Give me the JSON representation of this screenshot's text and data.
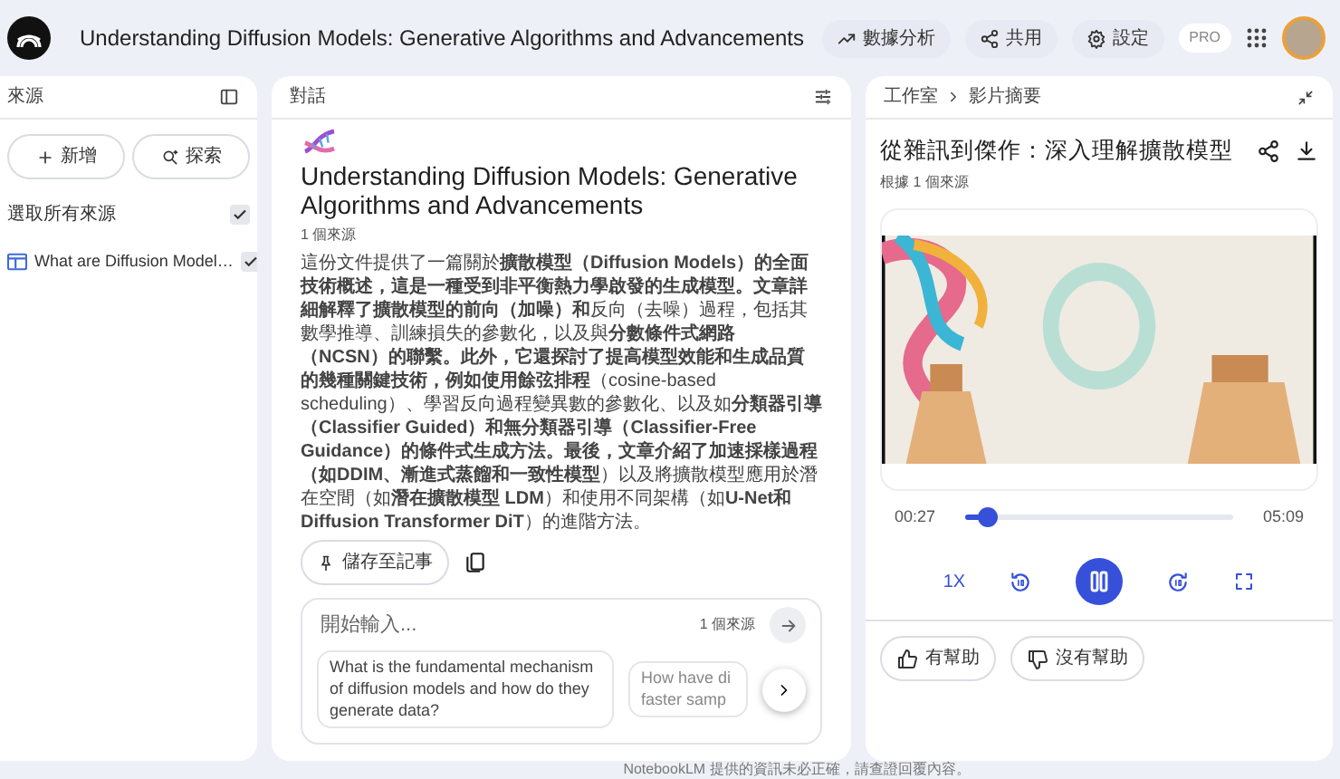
{
  "header": {
    "title": "Understanding Diffusion Models: Generative Algorithms and Advancements",
    "actions": [
      {
        "kind": "analytics",
        "label": "數據分析"
      },
      {
        "kind": "share",
        "label": "共用"
      },
      {
        "kind": "settings",
        "label": "設定"
      }
    ],
    "badge": "PRO"
  },
  "sources_panel": {
    "title": "來源",
    "buttons": [
      {
        "kind": "add",
        "label": "新增"
      },
      {
        "kind": "discover",
        "label": "探索"
      }
    ],
    "select_all": {
      "label": "選取所有來源",
      "checked": true
    },
    "sources": [
      {
        "title": "What are Diffusion Model…",
        "checked": true
      }
    ]
  },
  "chat_panel": {
    "title": "對話",
    "heading": "Understanding Diffusion Models: Generative Algorithms and Advancements",
    "source_count": "1 個來源",
    "summary": "這份文件提供了一篇關於**擴散模型（Diffusion Models）的全面技術概述，這是一種受到非平衡熱力學啟發的生成模型。文章詳細解釋了擴散模型的前向（加噪）和**反向（去噪）過程，包括其數學推導、訓練損失的參數化，以及與**分數條件式網路（NCSN）的聯繫。此外，它還探討了提高模型效能和生成品質的幾種關鍵技術，例如使用餘弦排程**（cosine-based scheduling）、學習反向過程變異數的參數化、以及如**分類器引導（Classifier Guided）和無分類器引導（Classifier-Free Guidance）的條件式生成方法。最後，文章介紹了加速採樣過程（如DDIM、漸進式蒸餾和一致性模型**）以及將擴散模型應用於潛在空間（如**潛在擴散模型 LDM**）和使用不同架構（如**U-Net和Diffusion Transformer DiT**）的進階方法。",
    "save_button": "儲存至記事",
    "input": {
      "placeholder": "開始輸入...",
      "source_count": "1 個來源"
    },
    "suggestions": [
      "What is the fundamental mechanism of diffusion models and how do they generate data?",
      "How have di faster samp"
    ]
  },
  "studio_panel": {
    "breadcrumb": [
      "工作室",
      "影片摘要"
    ],
    "title": "從雜訊到傑作：深入理解擴散模型",
    "subtitle": "根據 1 個來源",
    "player": {
      "elapsed": "00:27",
      "duration": "05:09",
      "level": 0.087,
      "playing": true,
      "speed": "1X"
    },
    "feedback": [
      {
        "kind": "up",
        "label": "有幫助"
      },
      {
        "kind": "down",
        "label": "沒有幫助"
      }
    ]
  },
  "footer": "NotebookLM 提供的資訊未必正確，請查證回覆內容。"
}
